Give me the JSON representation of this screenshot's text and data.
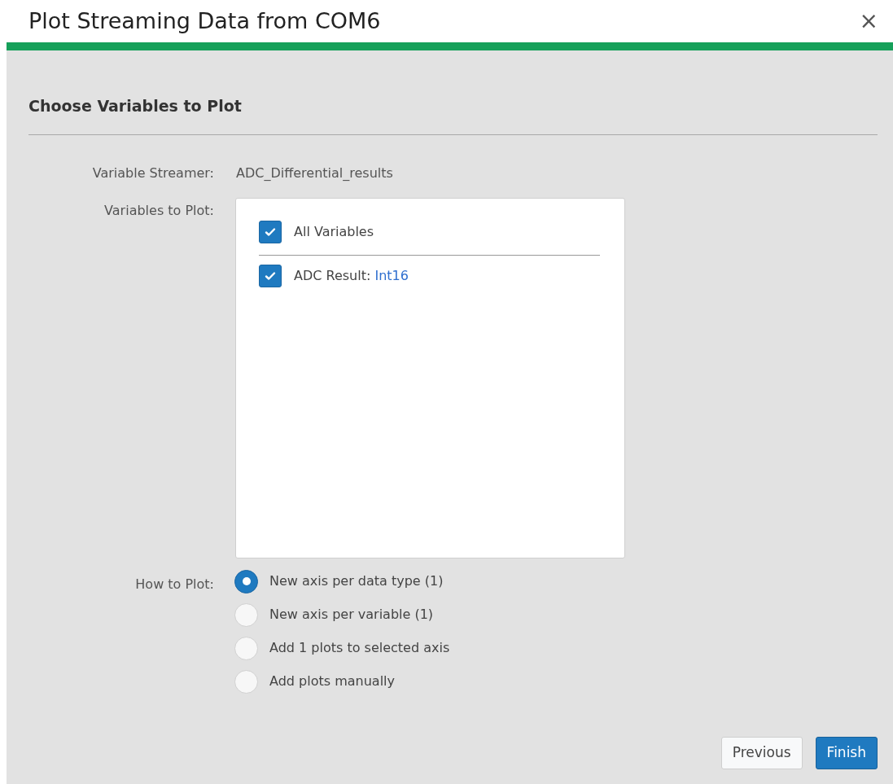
{
  "window": {
    "title": "Plot Streaming Data from COM6",
    "close": "×"
  },
  "section_title": "Choose Variables to Plot",
  "streamer": {
    "label": "Variable Streamer:",
    "value": "ADC_Differential_results"
  },
  "variables": {
    "label": "Variables to Plot:",
    "all": {
      "label": "All Variables",
      "checked": true
    },
    "items": [
      {
        "name": "ADC Result:",
        "type": "Int16",
        "checked": true
      }
    ]
  },
  "how_to_plot": {
    "label": "How to Plot:",
    "options": [
      {
        "label": "New axis per data type (1)",
        "selected": true
      },
      {
        "label": "New axis per variable (1)",
        "selected": false
      },
      {
        "label": "Add 1 plots to selected axis",
        "selected": false
      },
      {
        "label": "Add plots manually",
        "selected": false
      }
    ]
  },
  "buttons": [
    {
      "label": "Previous",
      "kind": "secondary"
    },
    {
      "label": "Finish",
      "kind": "primary"
    }
  ]
}
